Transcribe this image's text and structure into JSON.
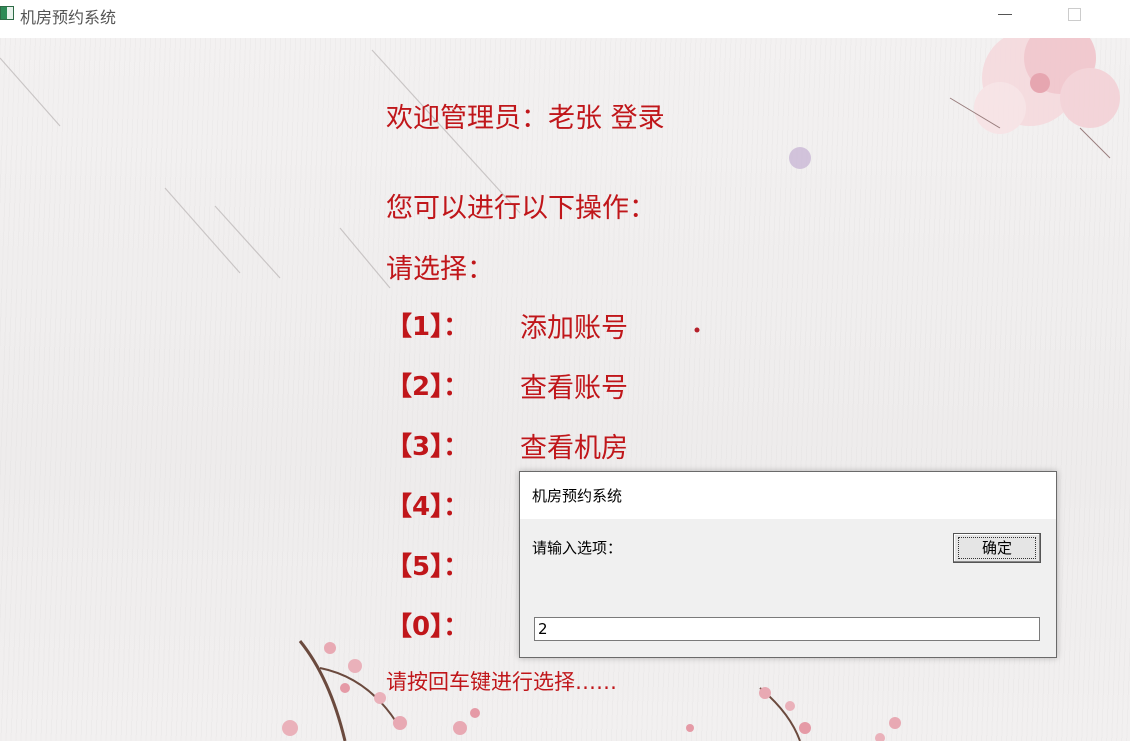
{
  "window": {
    "title": "机房预约系统"
  },
  "console": {
    "welcome": "欢迎管理员：老张    登录",
    "prompt_ops": "您可以进行以下操作：",
    "prompt_choose": "请选择：",
    "menu": [
      {
        "key": "【1】：",
        "label": "添加账号"
      },
      {
        "key": "【2】：",
        "label": "查看账号"
      },
      {
        "key": "【3】：",
        "label": "查看机房"
      },
      {
        "key": "【4】：",
        "label": ""
      },
      {
        "key": "【5】：",
        "label": ""
      },
      {
        "key": "【0】：",
        "label": ""
      }
    ],
    "enter_hint": "请按回车键进行选择……"
  },
  "dialog": {
    "title": "机房预约系统",
    "prompt": "请输入选项：",
    "ok_label": "确定",
    "input_value": "2"
  },
  "colors": {
    "text_red": "#c0161a",
    "blossom": "#e8a9b3"
  }
}
